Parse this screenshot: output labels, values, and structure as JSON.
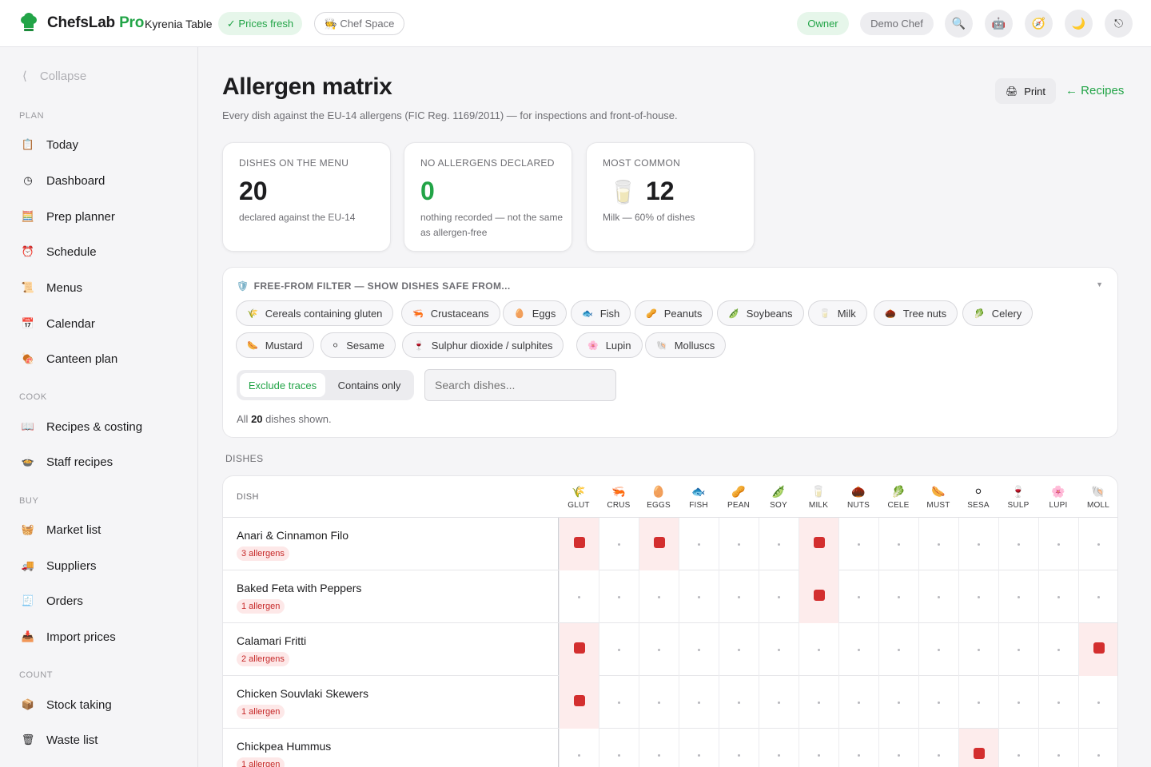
{
  "topbar": {
    "brand": "ChefsLab",
    "brand_suffix": "Pro",
    "venue": "Kyrenia Table",
    "status_pill": "✓ Prices fresh",
    "space_pill": "🧑‍🍳 Chef Space",
    "role": "Owner",
    "user": "Demo Chef"
  },
  "sidebar": {
    "collapse": "Collapse",
    "sections": [
      {
        "label": "PLAN",
        "items": [
          "Today",
          "Dashboard",
          "Prep planner",
          "Schedule",
          "Menus",
          "Calendar",
          "Canteen plan"
        ]
      },
      {
        "label": "COOK",
        "items": [
          "Recipes & costing",
          "Staff recipes"
        ]
      },
      {
        "label": "BUY",
        "items": [
          "Market list",
          "Suppliers",
          "Orders",
          "Import prices"
        ]
      },
      {
        "label": "COUNT",
        "items": [
          "Stock taking",
          "Waste list"
        ]
      }
    ]
  },
  "page": {
    "title": "Allergen matrix",
    "subtitle": "Every dish against the EU-14 allergens (FIC Reg. 1169/2011) — for inspections and front-of-house.",
    "print_label": "Print",
    "recipes_link": "← Recipes"
  },
  "stats": [
    {
      "label": "DISHES ON THE MENU",
      "value": "20",
      "sub": "declared against the EU-14",
      "color": "#1d1d1f"
    },
    {
      "label": "NO ALLERGENS DECLARED",
      "value": "0",
      "sub": "nothing recorded — not the same as allergen-free",
      "color": "#22a447"
    },
    {
      "label": "MOST COMMON",
      "value": "12",
      "sub": "Milk — 60% of dishes",
      "color": "#1d1d1f"
    }
  ],
  "filter": {
    "title": "FREE-FROM FILTER — SHOW DISHES SAFE FROM...",
    "allergens": [
      "Cereals containing gluten",
      "Crustaceans",
      "Eggs",
      "Fish",
      "Peanuts",
      "Soybeans",
      "Milk",
      "Tree nuts",
      "Celery",
      "Mustard",
      "Sesame",
      "Sulphur dioxide / sulphites",
      "Lupin",
      "Molluscs"
    ],
    "mode_exclude": "Exclude traces",
    "mode_contains": "Contains only",
    "search_placeholder": "Search dishes...",
    "shown_prefix": "All",
    "shown_count": "20",
    "shown_suffix": "dishes shown."
  },
  "matrix": {
    "section_label": "DISHES",
    "dish_header": "DISH",
    "columns": [
      "GLUT",
      "CRUS",
      "EGGS",
      "FISH",
      "PEAN",
      "SOY",
      "MILK",
      "NUTS",
      "CELE",
      "MUST",
      "SESA",
      "SULP",
      "LUPI",
      "MOLL"
    ],
    "icons": [
      "🌾",
      "🦐",
      "🥚",
      "🐟",
      "🥜",
      "🫛",
      "🥛",
      "🌰",
      "🥬",
      "🌭",
      "⚪",
      "🍷",
      "🌸",
      "🐚"
    ],
    "rows": [
      {
        "name": "Anari & Cinnamon Filo",
        "badge": "3 allergens",
        "flags": [
          "GLUT",
          "EGGS",
          "MILK"
        ]
      },
      {
        "name": "Baked Feta with Peppers",
        "badge": "1 allergen",
        "flags": [
          "MILK"
        ]
      },
      {
        "name": "Calamari Fritti",
        "badge": "2 allergens",
        "flags": [
          "GLUT",
          "MOLL"
        ]
      },
      {
        "name": "Chicken Souvlaki Skewers",
        "badge": "1 allergen",
        "flags": [
          "GLUT"
        ]
      },
      {
        "name": "Chickpea Hummus",
        "badge": "1 allergen",
        "flags": [
          "SESA"
        ]
      }
    ]
  },
  "colors": {
    "accent": "#22a447",
    "danger": "#d32f2f",
    "danger_bg": "#fdecec"
  }
}
